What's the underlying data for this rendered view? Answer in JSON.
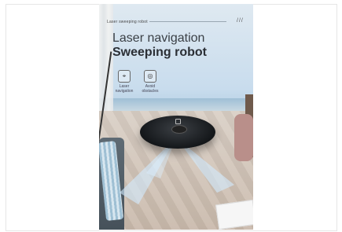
{
  "poster": {
    "top_label": "Laser sweeping robot",
    "dots": "///",
    "title_line1": "Laser navigation",
    "title_line2": "Sweeping robot",
    "features": [
      {
        "label": "Laser\nnavigation",
        "icon": "location-pin-icon"
      },
      {
        "label": "Avoid\nobstacles",
        "icon": "robot-sensor-icon"
      }
    ]
  }
}
